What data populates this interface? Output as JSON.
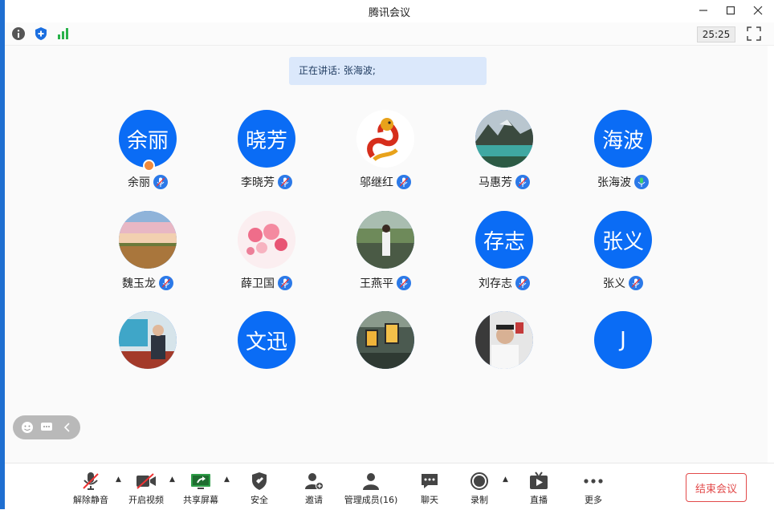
{
  "window": {
    "title": "腾讯会议"
  },
  "toolbar": {
    "timer": "25:25"
  },
  "speaking": {
    "text": "正在讲话: 张海波;"
  },
  "participants": [
    {
      "name": "余丽",
      "avatar_text": "余丽",
      "avatar": "text",
      "host": true
    },
    {
      "name": "李晓芳",
      "avatar_text": "晓芳",
      "avatar": "text"
    },
    {
      "name": "邬继红",
      "avatar_text": "",
      "avatar": "dragon"
    },
    {
      "name": "马惠芳",
      "avatar_text": "",
      "avatar": "lake"
    },
    {
      "name": "张海波",
      "avatar_text": "海波",
      "avatar": "text",
      "speaking": true
    },
    {
      "name": "魏玉龙",
      "avatar_text": "",
      "avatar": "sunset"
    },
    {
      "name": "薛卫国",
      "avatar_text": "",
      "avatar": "flowers"
    },
    {
      "name": "王燕平",
      "avatar_text": "",
      "avatar": "park"
    },
    {
      "name": "刘存志",
      "avatar_text": "存志",
      "avatar": "text"
    },
    {
      "name": "张义",
      "avatar_text": "张义",
      "avatar": "text"
    },
    {
      "name": "",
      "avatar_text": "",
      "avatar": "presenter"
    },
    {
      "name": "",
      "avatar_text": "文迅",
      "avatar": "text"
    },
    {
      "name": "",
      "avatar_text": "",
      "avatar": "lamps"
    },
    {
      "name": "",
      "avatar_text": "",
      "avatar": "doctor"
    },
    {
      "name": "",
      "avatar_text": "J",
      "avatar": "text"
    }
  ],
  "bottombar": {
    "unmute": "解除静音",
    "start_video": "开启视频",
    "share_screen": "共享屏幕",
    "security": "安全",
    "invite": "邀请",
    "manage_members": "管理成员(16)",
    "chat": "聊天",
    "record": "录制",
    "live": "直播",
    "more": "更多",
    "end_meeting": "结束会议"
  },
  "colors": {
    "accent": "#0a6cf5",
    "end": "#e24a4a",
    "speaking_bg": "#dbe8fb"
  }
}
